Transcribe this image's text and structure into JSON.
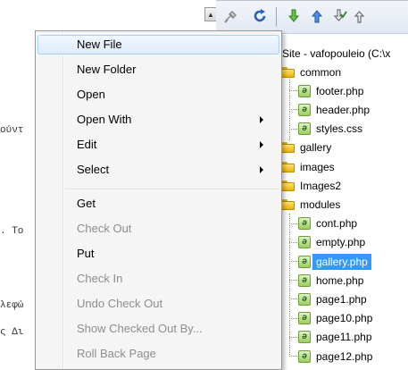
{
  "editor": {
    "fragments": [
      "ούντ",
      ". Το",
      "λεφώ",
      "ς Δι"
    ]
  },
  "toolbar": {
    "icons": [
      "connect-icon",
      "refresh-icon",
      "get-files-icon",
      "put-files-icon",
      "check-out-icon",
      "check-in-icon"
    ]
  },
  "file_panel": {
    "site_label": "Site - vafopouleio (C:\\x",
    "tree": [
      {
        "type": "folder",
        "name": "common",
        "level": 0
      },
      {
        "type": "file",
        "name": "footer.php",
        "level": 1
      },
      {
        "type": "file",
        "name": "header.php",
        "level": 1
      },
      {
        "type": "file",
        "name": "styles.css",
        "level": 1
      },
      {
        "type": "folder",
        "name": "gallery",
        "level": 0
      },
      {
        "type": "folder",
        "name": "images",
        "level": 0
      },
      {
        "type": "folder",
        "name": "Images2",
        "level": 0
      },
      {
        "type": "folder",
        "name": "modules",
        "level": 0
      },
      {
        "type": "file",
        "name": "cont.php",
        "level": 1
      },
      {
        "type": "file",
        "name": "empty.php",
        "level": 1
      },
      {
        "type": "file",
        "name": "gallery.php",
        "level": 1,
        "selected": true
      },
      {
        "type": "file",
        "name": "home.php",
        "level": 1
      },
      {
        "type": "file",
        "name": "page1.php",
        "level": 1
      },
      {
        "type": "file",
        "name": "page10.php",
        "level": 1
      },
      {
        "type": "file",
        "name": "page11.php",
        "level": 1
      },
      {
        "type": "file",
        "name": "page12.php",
        "level": 1
      }
    ],
    "selection_color": "#3399ff"
  },
  "context_menu": {
    "items": [
      {
        "label": "New File",
        "state": "highlighted"
      },
      {
        "label": "New Folder",
        "state": "enabled"
      },
      {
        "label": "Open",
        "state": "enabled"
      },
      {
        "label": "Open With",
        "state": "enabled",
        "submenu": true
      },
      {
        "label": "Edit",
        "state": "enabled",
        "submenu": true
      },
      {
        "label": "Select",
        "state": "enabled",
        "submenu": true
      },
      {
        "separator": true
      },
      {
        "label": "Get",
        "state": "enabled"
      },
      {
        "label": "Check Out",
        "state": "disabled"
      },
      {
        "label": "Put",
        "state": "enabled"
      },
      {
        "label": "Check In",
        "state": "disabled"
      },
      {
        "label": "Undo Check Out",
        "state": "disabled"
      },
      {
        "label": "Show Checked Out By...",
        "state": "disabled"
      },
      {
        "label": "Roll Back Page",
        "state": "disabled"
      }
    ],
    "highlight_color": "#dcebfc",
    "disabled_color": "#8d8d8d"
  }
}
